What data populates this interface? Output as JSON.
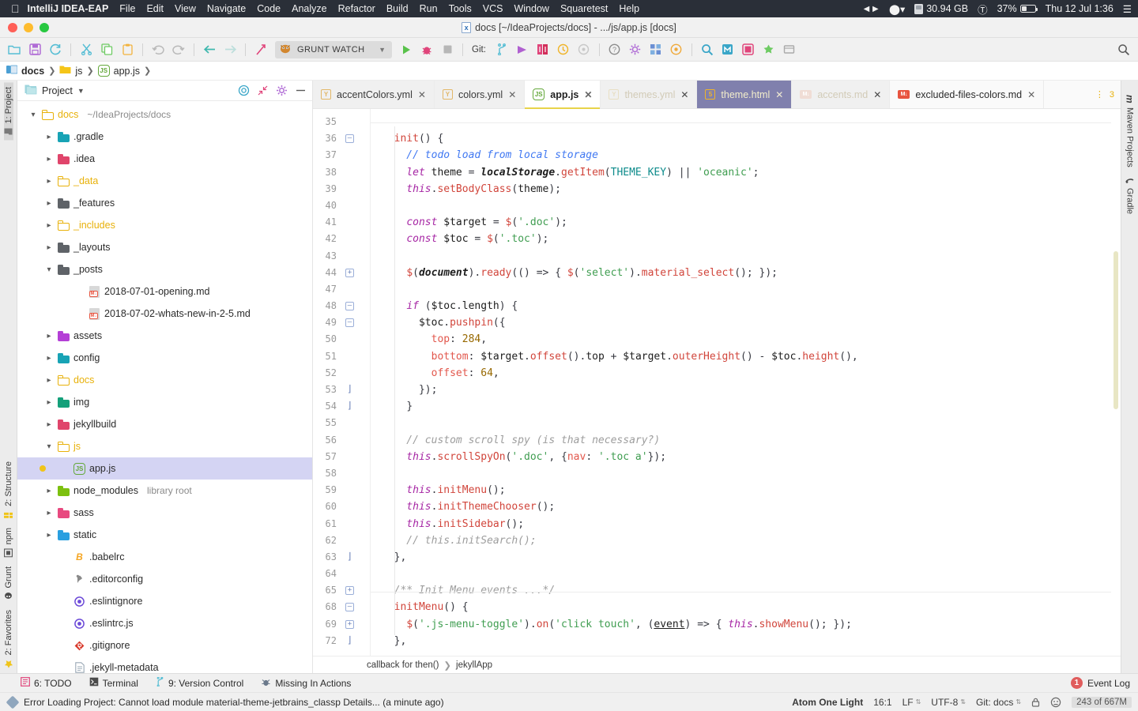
{
  "macbar": {
    "app_name": "IntelliJ IDEA-EAP",
    "menus": [
      "File",
      "Edit",
      "View",
      "Navigate",
      "Code",
      "Analyze",
      "Refactor",
      "Build",
      "Run",
      "Tools",
      "VCS",
      "Window",
      "Squaretest",
      "Help"
    ],
    "disk_space": "30.94 GB",
    "battery_percent": "37%",
    "clock": "Thu 12 Jul  1:36"
  },
  "titlebar": {
    "title": "docs [~/IdeaProjects/docs] - .../js/app.js [docs]"
  },
  "toolbar": {
    "run_config_label": "GRUNT WATCH",
    "git_label": "Git:"
  },
  "navbar": {
    "crumbs": [
      {
        "label": "docs",
        "icon": "module-icon"
      },
      {
        "label": "js",
        "icon": "folder-icon"
      },
      {
        "label": "app.js",
        "icon": "js-file-icon"
      }
    ]
  },
  "left_strip": {
    "tabs": [
      "1: Project",
      "2: Structure",
      "npm",
      "Grunt",
      "2: Favorites"
    ]
  },
  "right_strip": {
    "tabs": [
      "Maven Projects",
      "Gradle"
    ]
  },
  "project_panel": {
    "title": "Project",
    "tree": [
      {
        "indent": 0,
        "arrow": "down",
        "icon": "folder-outline-yellow",
        "label": "docs",
        "label_color": "yellow",
        "sub": "~/IdeaProjects/docs",
        "selected": false,
        "marked": false
      },
      {
        "indent": 1,
        "arrow": "right",
        "icon": "folder-teal",
        "label": ".gradle",
        "label_color": "normal",
        "sub": "",
        "selected": false,
        "marked": false
      },
      {
        "indent": 1,
        "arrow": "right",
        "icon": "folder-red",
        "label": ".idea",
        "label_color": "normal",
        "sub": "",
        "selected": false,
        "marked": false
      },
      {
        "indent": 1,
        "arrow": "right",
        "icon": "folder-outline-yellow",
        "label": "_data",
        "label_color": "yellow",
        "sub": "",
        "selected": false,
        "marked": false
      },
      {
        "indent": 1,
        "arrow": "right",
        "icon": "folder-gray",
        "label": "_features",
        "label_color": "normal",
        "sub": "",
        "selected": false,
        "marked": false
      },
      {
        "indent": 1,
        "arrow": "right",
        "icon": "folder-outline-yellow",
        "label": "_includes",
        "label_color": "yellow",
        "sub": "",
        "selected": false,
        "marked": false
      },
      {
        "indent": 1,
        "arrow": "right",
        "icon": "folder-gray",
        "label": "_layouts",
        "label_color": "normal",
        "sub": "",
        "selected": false,
        "marked": false
      },
      {
        "indent": 1,
        "arrow": "down",
        "icon": "folder-gray",
        "label": "_posts",
        "label_color": "normal",
        "sub": "",
        "selected": false,
        "marked": false
      },
      {
        "indent": 3,
        "arrow": "none",
        "icon": "md-file",
        "label": "2018-07-01-opening.md",
        "label_color": "normal",
        "sub": "",
        "selected": false,
        "marked": false
      },
      {
        "indent": 3,
        "arrow": "none",
        "icon": "md-file",
        "label": "2018-07-02-whats-new-in-2-5.md",
        "label_color": "normal",
        "sub": "",
        "selected": false,
        "marked": false
      },
      {
        "indent": 1,
        "arrow": "right",
        "icon": "folder-purple",
        "label": "assets",
        "label_color": "normal",
        "sub": "",
        "selected": false,
        "marked": false
      },
      {
        "indent": 1,
        "arrow": "right",
        "icon": "folder-teal",
        "label": "config",
        "label_color": "normal",
        "sub": "",
        "selected": false,
        "marked": false
      },
      {
        "indent": 1,
        "arrow": "right",
        "icon": "folder-outline-yellow",
        "label": "docs",
        "label_color": "yellow",
        "sub": "",
        "selected": false,
        "marked": false
      },
      {
        "indent": 1,
        "arrow": "right",
        "icon": "folder-green",
        "label": "img",
        "label_color": "normal",
        "sub": "",
        "selected": false,
        "marked": false
      },
      {
        "indent": 1,
        "arrow": "right",
        "icon": "folder-red",
        "label": "jekyllbuild",
        "label_color": "normal",
        "sub": "",
        "selected": false,
        "marked": false
      },
      {
        "indent": 1,
        "arrow": "down",
        "icon": "folder-outline-yellow",
        "label": "js",
        "label_color": "yellow",
        "sub": "",
        "selected": false,
        "marked": false
      },
      {
        "indent": 2,
        "arrow": "none",
        "icon": "js-file",
        "label": "app.js",
        "label_color": "normal",
        "sub": "",
        "selected": true,
        "marked": true
      },
      {
        "indent": 1,
        "arrow": "right",
        "icon": "folder-lime",
        "label": "node_modules",
        "label_color": "normal",
        "sub": "library root",
        "selected": false,
        "marked": false
      },
      {
        "indent": 1,
        "arrow": "right",
        "icon": "folder-pink",
        "label": "sass",
        "label_color": "normal",
        "sub": "",
        "selected": false,
        "marked": false
      },
      {
        "indent": 1,
        "arrow": "right",
        "icon": "folder-blue",
        "label": "static",
        "label_color": "normal",
        "sub": "",
        "selected": false,
        "marked": false
      },
      {
        "indent": 2,
        "arrow": "none",
        "icon": "babel-file",
        "label": ".babelrc",
        "label_color": "normal",
        "sub": "",
        "selected": false,
        "marked": false
      },
      {
        "indent": 2,
        "arrow": "none",
        "icon": "editorconfig-file",
        "label": ".editorconfig",
        "label_color": "normal",
        "sub": "",
        "selected": false,
        "marked": false
      },
      {
        "indent": 2,
        "arrow": "none",
        "icon": "eslint-file",
        "label": ".eslintignore",
        "label_color": "normal",
        "sub": "",
        "selected": false,
        "marked": false
      },
      {
        "indent": 2,
        "arrow": "none",
        "icon": "eslint-file",
        "label": ".eslintrc.js",
        "label_color": "normal",
        "sub": "",
        "selected": false,
        "marked": false
      },
      {
        "indent": 2,
        "arrow": "none",
        "icon": "git-file",
        "label": ".gitignore",
        "label_color": "normal",
        "sub": "",
        "selected": false,
        "marked": false
      },
      {
        "indent": 2,
        "arrow": "none",
        "icon": "text-file",
        "label": ".jekyll-metadata",
        "label_color": "normal",
        "sub": "",
        "selected": false,
        "marked": false
      }
    ]
  },
  "editor": {
    "tabs": [
      {
        "label": "accentColors.yml",
        "icon": "yml-icon",
        "state": "inactive"
      },
      {
        "label": "colors.yml",
        "icon": "yml-icon",
        "state": "inactive"
      },
      {
        "label": "app.js",
        "icon": "js-icon",
        "state": "active"
      },
      {
        "label": "themes.yml",
        "icon": "yml-icon",
        "state": "dim"
      },
      {
        "label": "theme.html",
        "icon": "html5-icon",
        "state": "purple"
      },
      {
        "label": "accents.md",
        "icon": "md-icon",
        "state": "dim-md"
      },
      {
        "label": "excluded-files-colors.md",
        "icon": "md-icon",
        "state": "inactive-flat"
      }
    ],
    "tab_overflow_count": "3",
    "breadcrumb": [
      "callback for then()",
      "jekyllApp"
    ],
    "lines": [
      {
        "num": "35",
        "fold": "",
        "text": ""
      },
      {
        "num": "36",
        "fold": "minus",
        "text": "  init() {"
      },
      {
        "num": "37",
        "fold": "",
        "text": "    // todo load from local storage"
      },
      {
        "num": "38",
        "fold": "",
        "text": "    let theme = localStorage.getItem(THEME_KEY) || 'oceanic';"
      },
      {
        "num": "39",
        "fold": "",
        "text": "    this.setBodyClass(theme);"
      },
      {
        "num": "40",
        "fold": "",
        "text": ""
      },
      {
        "num": "41",
        "fold": "",
        "text": "    const $target = $('.doc');"
      },
      {
        "num": "42",
        "fold": "",
        "text": "    const $toc = $('.toc');"
      },
      {
        "num": "43",
        "fold": "",
        "text": ""
      },
      {
        "num": "44",
        "fold": "plus",
        "text": "    $(document).ready(() => { $('select').material_select(); });"
      },
      {
        "num": "47",
        "fold": "",
        "text": ""
      },
      {
        "num": "48",
        "fold": "minus",
        "text": "    if ($toc.length) {"
      },
      {
        "num": "49",
        "fold": "minus",
        "text": "      $toc.pushpin({"
      },
      {
        "num": "50",
        "fold": "",
        "text": "        top: 284,"
      },
      {
        "num": "51",
        "fold": "",
        "text": "        bottom: $target.offset().top + $target.outerHeight() - $toc.height(),"
      },
      {
        "num": "52",
        "fold": "",
        "text": "        offset: 64,"
      },
      {
        "num": "53",
        "fold": "bracket",
        "text": "      });"
      },
      {
        "num": "54",
        "fold": "bracket",
        "text": "    }"
      },
      {
        "num": "55",
        "fold": "",
        "text": ""
      },
      {
        "num": "56",
        "fold": "",
        "text": "    // custom scroll spy (is that necessary?)"
      },
      {
        "num": "57",
        "fold": "",
        "text": "    this.scrollSpyOn('.doc', {nav: '.toc a'});"
      },
      {
        "num": "58",
        "fold": "",
        "text": ""
      },
      {
        "num": "59",
        "fold": "",
        "text": "    this.initMenu();"
      },
      {
        "num": "60",
        "fold": "",
        "text": "    this.initThemeChooser();"
      },
      {
        "num": "61",
        "fold": "",
        "text": "    this.initSidebar();"
      },
      {
        "num": "62",
        "fold": "",
        "text": "    // this.initSearch();"
      },
      {
        "num": "63",
        "fold": "bracket",
        "text": "  },"
      },
      {
        "num": "64",
        "fold": "",
        "text": ""
      },
      {
        "num": "65",
        "fold": "plus",
        "text": "  /** Init Menu events ...*/"
      },
      {
        "num": "68",
        "fold": "minus",
        "text": "  initMenu() {"
      },
      {
        "num": "69",
        "fold": "plus",
        "text": "    $('.js-menu-toggle').on('click touch', (event) => { this.showMenu(); });"
      },
      {
        "num": "72",
        "fold": "bracket",
        "text": "  },"
      }
    ]
  },
  "toolwindow_bar": {
    "items": [
      {
        "label": "6: TODO",
        "icon": "todo-icon"
      },
      {
        "label": "Terminal",
        "icon": "terminal-icon"
      },
      {
        "label": "9: Version Control",
        "icon": "vcs-icon"
      },
      {
        "label": "Missing In Actions",
        "icon": "missing-actions-icon"
      }
    ],
    "event_log_label": "Event Log",
    "event_log_count": "1"
  },
  "statusbar": {
    "message": "Error Loading Project: Cannot load module material-theme-jetbrains_classp Details... (a minute ago)",
    "theme": "Atom One Light",
    "caret": "16:1",
    "line_sep": "LF",
    "encoding": "UTF-8",
    "git_branch": "Git: docs",
    "memory": "243 of 667M"
  }
}
